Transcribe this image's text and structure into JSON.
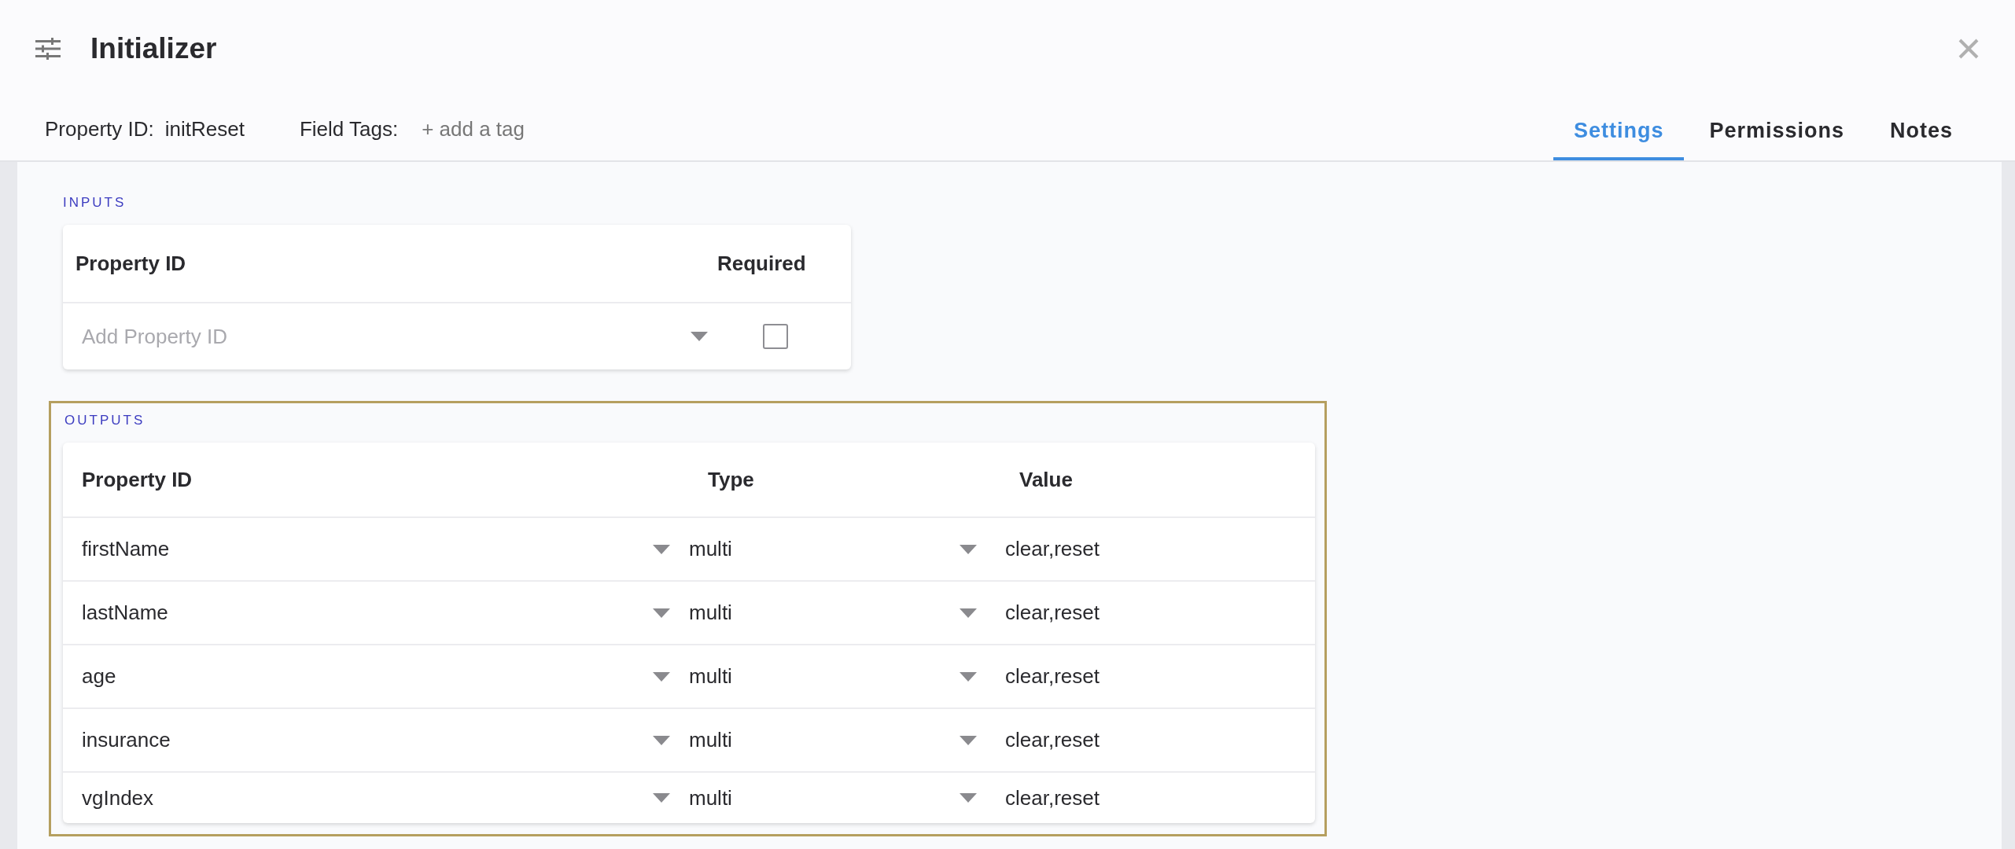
{
  "window": {
    "title": "Initializer"
  },
  "meta": {
    "property_id_label": "Property ID:",
    "property_id": "initReset",
    "field_tags_label": "Field Tags:",
    "add_tag": "+ add a tag"
  },
  "tabs": [
    {
      "label": "Settings",
      "selected": true
    },
    {
      "label": "Permissions",
      "selected": false
    },
    {
      "label": "Notes",
      "selected": false
    }
  ],
  "inputs": {
    "heading": "INPUTS",
    "columns": [
      "Property ID",
      "Required"
    ],
    "rows": [
      {
        "placeholder": "Add Property ID",
        "checked": false
      }
    ]
  },
  "outputs": {
    "heading": "OUTPUTS",
    "highlighted": true,
    "columns": [
      "Property ID",
      "Type",
      "Value"
    ],
    "rows": [
      {
        "property_id": "firstName",
        "type": "multi",
        "value": "clear,reset"
      },
      {
        "property_id": "lastName",
        "type": "multi",
        "value": "clear,reset"
      },
      {
        "property_id": "age",
        "type": "multi",
        "value": "clear,reset"
      },
      {
        "property_id": "insurance",
        "type": "multi",
        "value": "clear,reset"
      },
      {
        "property_id": "vgIndex",
        "type": "multi",
        "value": "clear,reset"
      }
    ]
  }
}
